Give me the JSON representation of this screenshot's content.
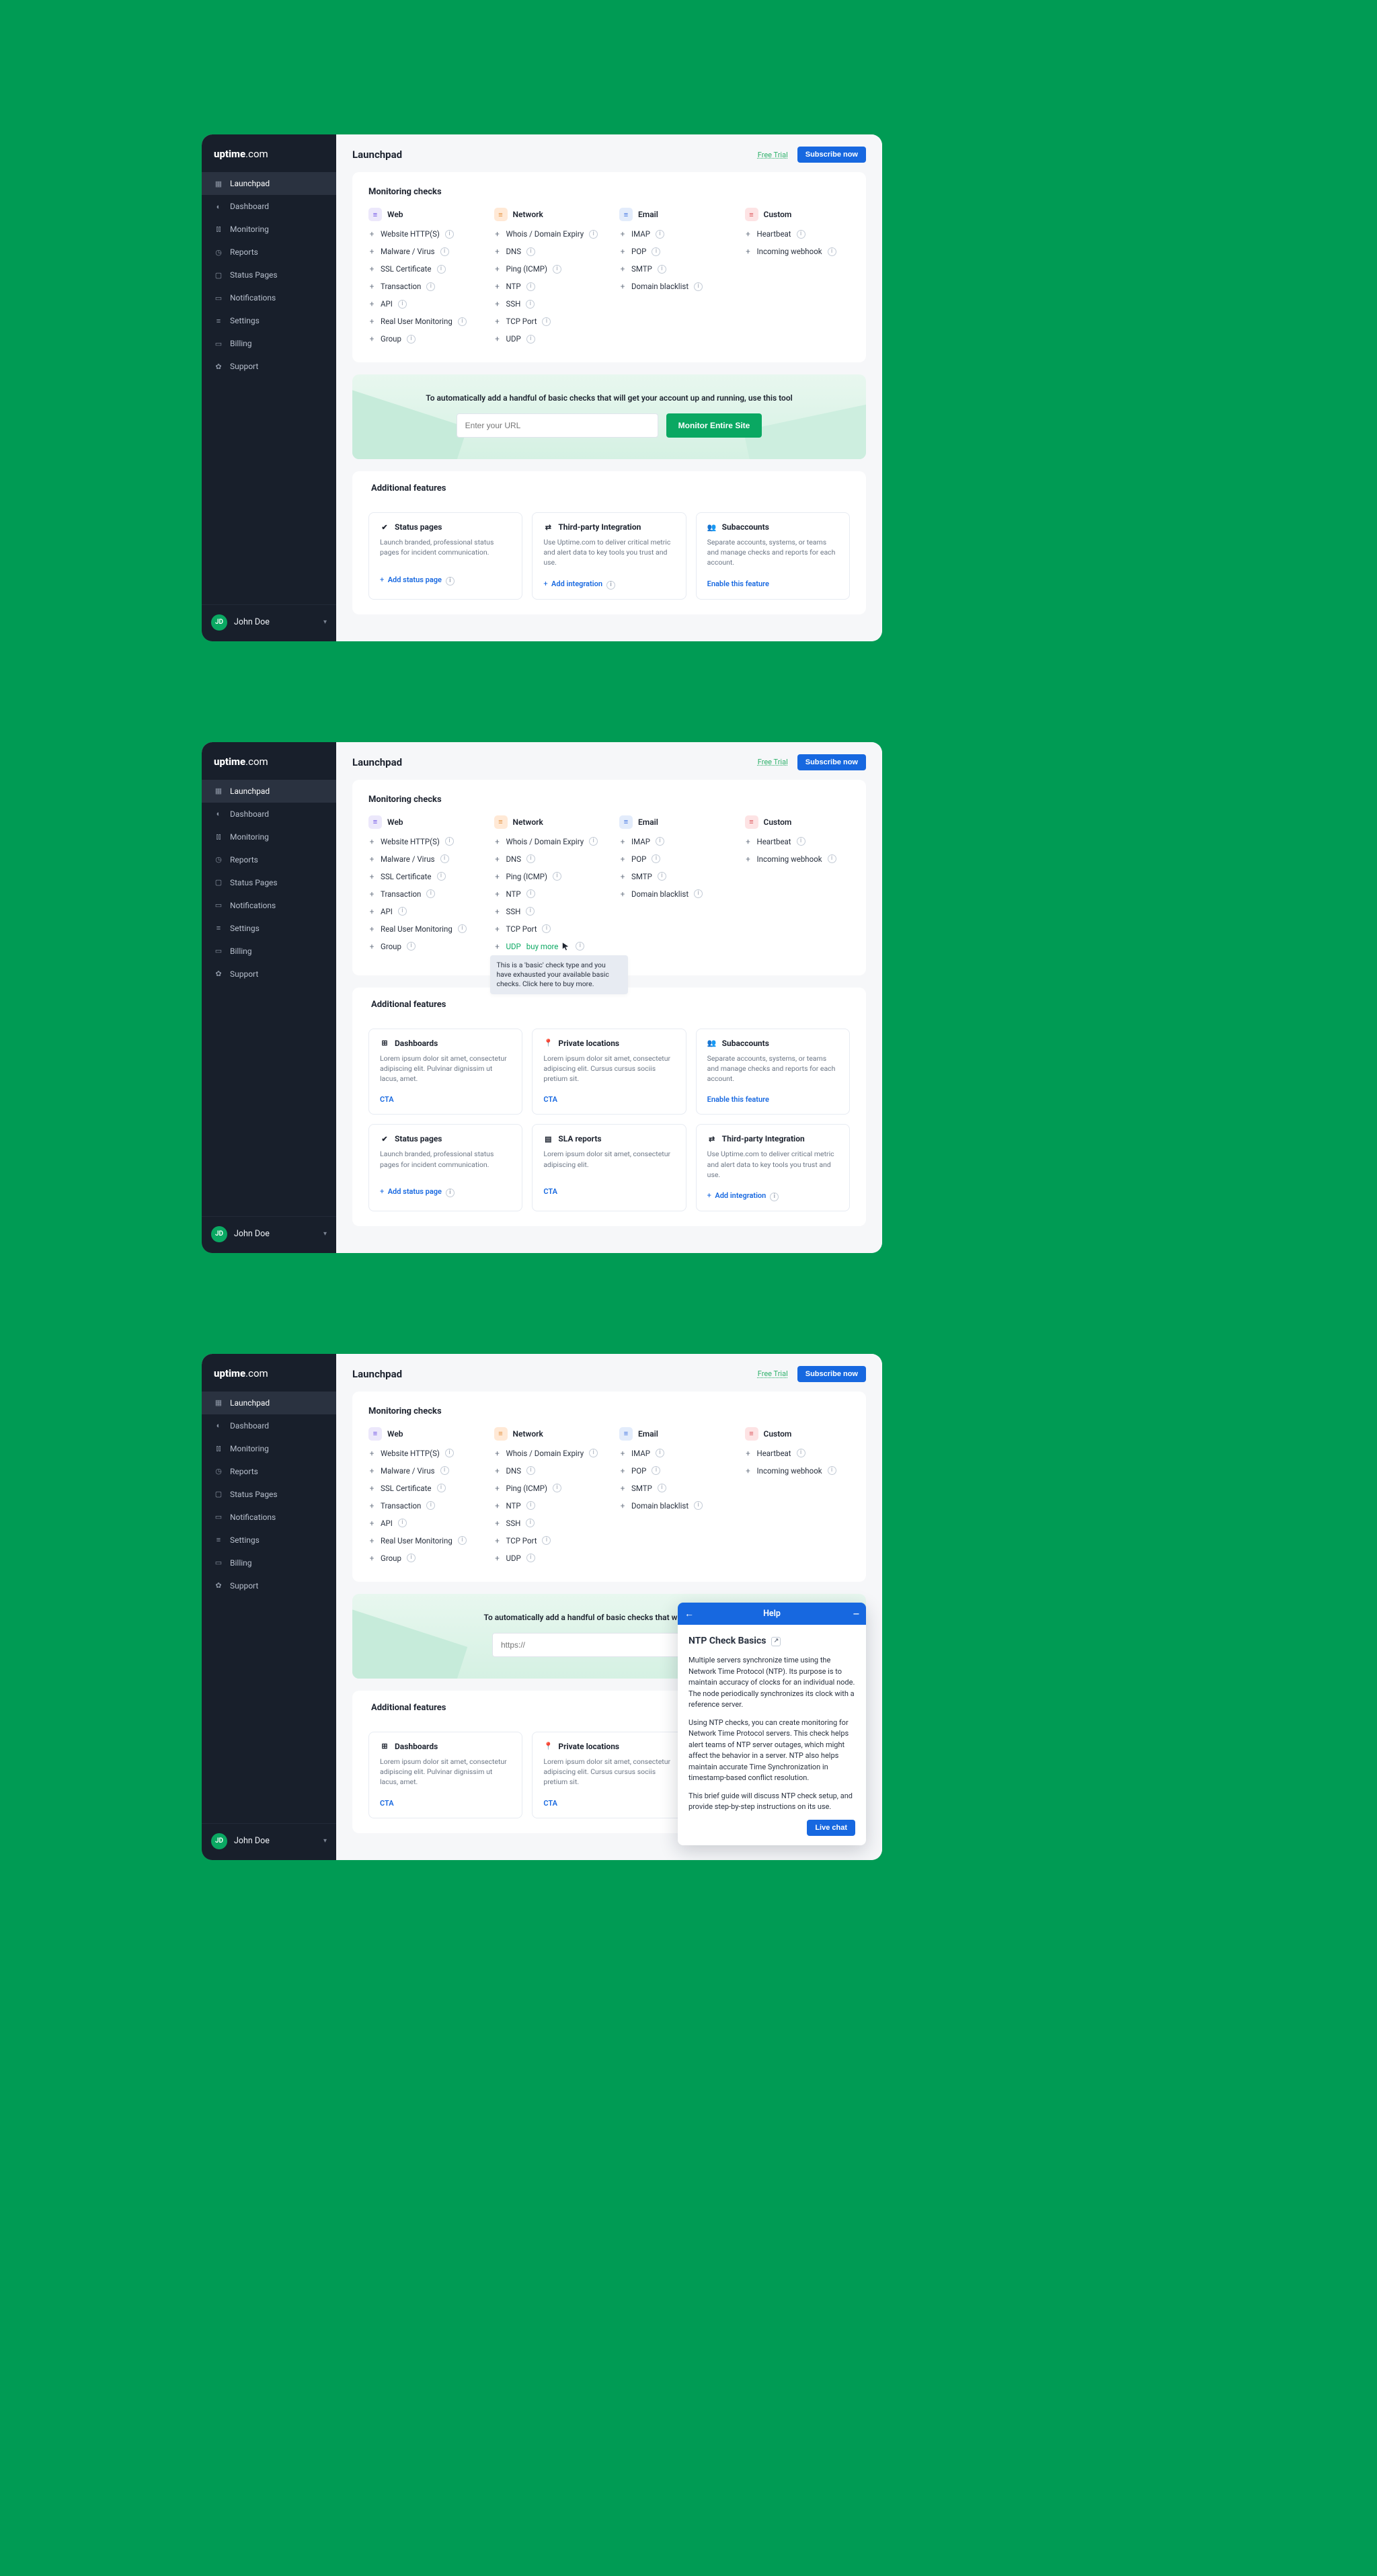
{
  "brand": {
    "name_pre": "uptime",
    "name_post": ".com"
  },
  "sidebar": {
    "items": [
      {
        "label": "Launchpad",
        "icon": "grid"
      },
      {
        "label": "Dashboard",
        "icon": "speed"
      },
      {
        "label": "Monitoring",
        "icon": "bars"
      },
      {
        "label": "Reports",
        "icon": "clock"
      },
      {
        "label": "Status Pages",
        "icon": "flag"
      },
      {
        "label": "Notifications",
        "icon": "screen"
      },
      {
        "label": "Settings",
        "icon": "sliders"
      },
      {
        "label": "Billing",
        "icon": "card"
      },
      {
        "label": "Support",
        "icon": "life"
      }
    ]
  },
  "user": {
    "initials": "JD",
    "name": "John Doe"
  },
  "header": {
    "title": "Launchpad",
    "free_trial": "Free Trial",
    "subscribe": "Subscribe now"
  },
  "monitoring": {
    "title": "Monitoring checks",
    "cols": [
      {
        "name": "Web",
        "cls": "web",
        "items": [
          "Website HTTP(S)",
          "Malware / Virus",
          "SSL Certificate",
          "Transaction",
          "API",
          "Real User Monitoring",
          "Group"
        ]
      },
      {
        "name": "Network",
        "cls": "net",
        "items": [
          "Whois / Domain Expiry",
          "DNS",
          "Ping (ICMP)",
          "NTP",
          "SSH",
          "TCP Port",
          "UDP"
        ]
      },
      {
        "name": "Email",
        "cls": "email",
        "items": [
          "IMAP",
          "POP",
          "SMTP",
          "Domain blacklist"
        ]
      },
      {
        "name": "Custom",
        "cls": "custom",
        "items": [
          "Heartbeat",
          "Incoming webhook"
        ]
      }
    ]
  },
  "hero": {
    "text": "To automatically add a handful of basic checks that will get your account up and running, use this tool",
    "placeholder1": "Enter your URL",
    "placeholder2": "https://",
    "button": "Monitor Entire Site"
  },
  "features": {
    "title": "Additional features",
    "v1": [
      {
        "icon": "status",
        "title": "Status pages",
        "desc": "Launch branded, professional status pages for incident communication.",
        "cta_type": "plus",
        "cta": "Add status page"
      },
      {
        "icon": "integration",
        "title": "Third-party Integration",
        "desc": "Use Uptime.com to deliver critical metric and alert data to key tools you trust and use.",
        "cta_type": "plus",
        "cta": "Add integration"
      },
      {
        "icon": "sub",
        "title": "Subaccounts",
        "desc": "Separate accounts, systems, or teams and manage checks and reports for each account.",
        "cta_type": "link",
        "cta": "Enable this feature"
      }
    ],
    "v2": [
      {
        "icon": "dash",
        "title": "Dashboards",
        "desc": "Lorem ipsum dolor sit amet, consectetur adipiscing elit. Pulvinar dignissim ut lacus, amet.",
        "cta_type": "link",
        "cta": "CTA"
      },
      {
        "icon": "loc",
        "title": "Private locations",
        "desc": "Lorem ipsum dolor sit amet, consectetur adipiscing elit. Cursus cursus sociis pretium sit.",
        "cta_type": "link",
        "cta": "CTA"
      },
      {
        "icon": "sub",
        "title": "Subaccounts",
        "desc": "Separate accounts, systems, or teams and manage checks and reports for each account.",
        "cta_type": "link",
        "cta": "Enable this feature"
      },
      {
        "icon": "status",
        "title": "Status pages",
        "desc": "Launch branded, professional status pages for incident communication.",
        "cta_type": "plus",
        "cta": "Add status page"
      },
      {
        "icon": "sla",
        "title": "SLA reports",
        "desc": "Lorem ipsum dolor sit amet, consectetur adipiscing elit.",
        "cta_type": "link",
        "cta": "CTA"
      },
      {
        "icon": "integration",
        "title": "Third-party Integration",
        "desc": "Use Uptime.com to deliver critical metric and alert data to key tools you trust and use.",
        "cta_type": "plus",
        "cta": "Add integration"
      }
    ],
    "v3": [
      {
        "icon": "dash",
        "title": "Dashboards",
        "desc": "Lorem ipsum dolor sit amet, consectetur adipiscing elit. Pulvinar dignissim ut lacus, amet.",
        "cta_type": "link",
        "cta": "CTA"
      },
      {
        "icon": "loc",
        "title": "Private locations",
        "desc": "Lorem ipsum dolor sit amet, consectetur adipiscing elit. Cursus cursus sociis pretium sit.",
        "cta_type": "link",
        "cta": "CTA"
      },
      {
        "icon": "sub",
        "title": "Subaccounts",
        "desc": "",
        "cta_type": "link",
        "cta": "Enable this feature"
      }
    ]
  },
  "udp_tooltip": {
    "buy": "buy more",
    "text": "This is a 'basic' check type and you have exhausted your available basic checks. Click here to buy more."
  },
  "help": {
    "title": "Help",
    "heading": "NTP Check Basics",
    "p1": "Multiple servers synchronize time using the Network Time Protocol (NTP). Its purpose is to maintain accuracy of clocks for an individual node. The node periodically synchronizes its clock with a reference server.",
    "p2": "Using NTP checks, you can create monitoring for Network Time Protocol servers. This check helps alert teams of NTP server outages, which might affect the behavior in a server. NTP also helps maintain accurate Time Synchronization in timestamp-based conflict resolution.",
    "p3": "This brief guide will discuss NTP check setup, and provide step-by-step instructions on its use.",
    "chat": "Live chat"
  },
  "hero3_text": "To automatically add a handful of basic checks that will get your acco"
}
